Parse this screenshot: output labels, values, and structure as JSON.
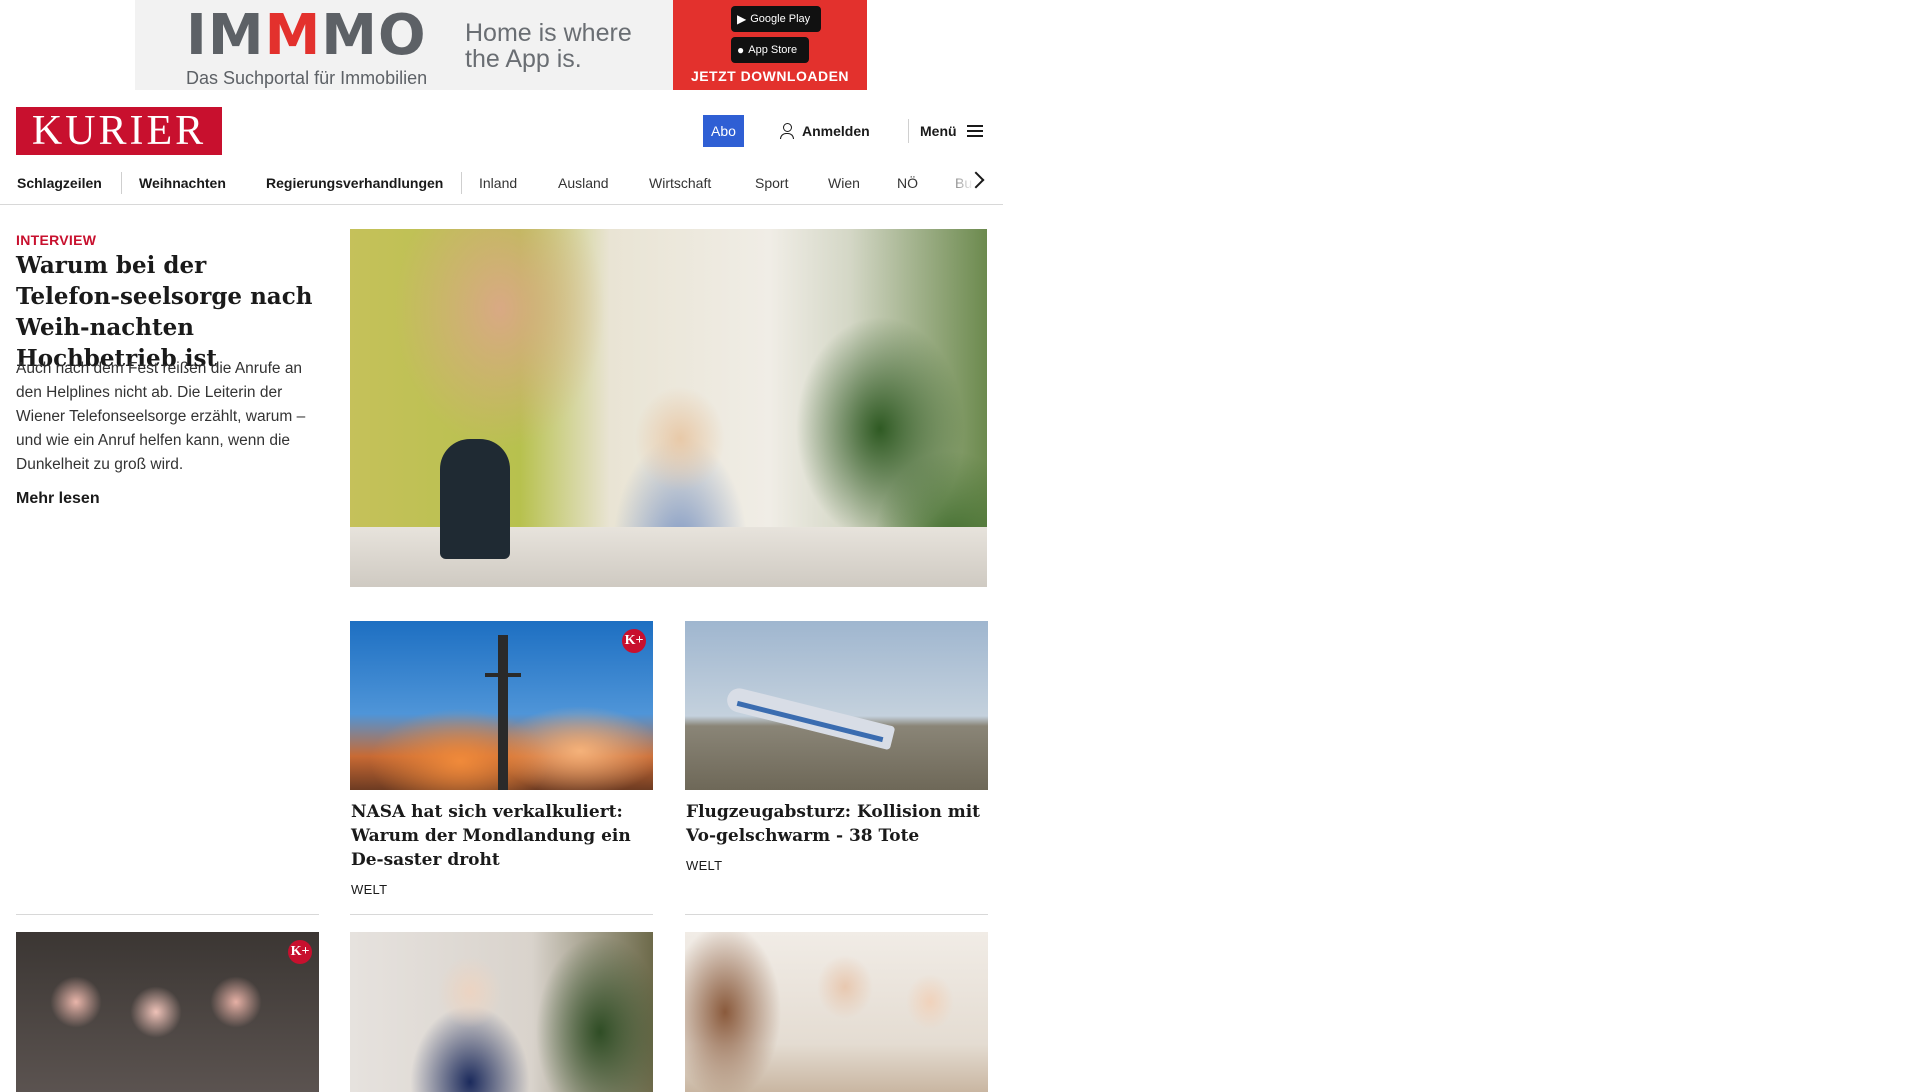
{
  "ad": {
    "logo": "IMMMO",
    "logo_a": "IM",
    "logo_b": "M",
    "logo_c": "MO",
    "subtitle": "Das Suchportal für Immobilien",
    "slogan_1": "Home is where",
    "slogan_2": "the App is.",
    "google_play": "Google Play",
    "app_store": "App Store",
    "download": "JETZT DOWNLOADEN",
    "brand_color": "#e3312d"
  },
  "header": {
    "logo": "KURIER",
    "abo": "Abo",
    "login": "Anmelden",
    "menu": "Menü",
    "brand_color": "#c8102e",
    "abo_color": "#2f5fd4"
  },
  "nav": {
    "items": [
      "Schlagzeilen",
      "Weihnachten",
      "Regierungsverhandlungen",
      "Inland",
      "Ausland",
      "Wirtschaft",
      "Sport",
      "Wien",
      "NÖ",
      "Bu"
    ]
  },
  "lead": {
    "kicker": "INTERVIEW",
    "title": "Warum bei der Telefon-seelsorge nach Weih-nachten Hochbetrieb ist",
    "text": "Auch nach dem Fest reißen die Anrufe an den Helplines nicht ab. Die Leiterin der Wiener Telefonseelsorge erzählt, warum – und wie ein Anruf helfen kann, wenn die Dunkelheit zu groß wird.",
    "more": "Mehr lesen"
  },
  "teasers": [
    {
      "title": "NASA hat sich verkalkuliert: Warum der Mondlandung ein De-saster droht",
      "section": "WELT",
      "premium": "K+"
    },
    {
      "title": "Flugzeugabsturz: Kollision mit Vo-gelschwarm - 38 Tote",
      "section": "WELT"
    }
  ],
  "row3": [
    {
      "premium": "K+"
    }
  ]
}
